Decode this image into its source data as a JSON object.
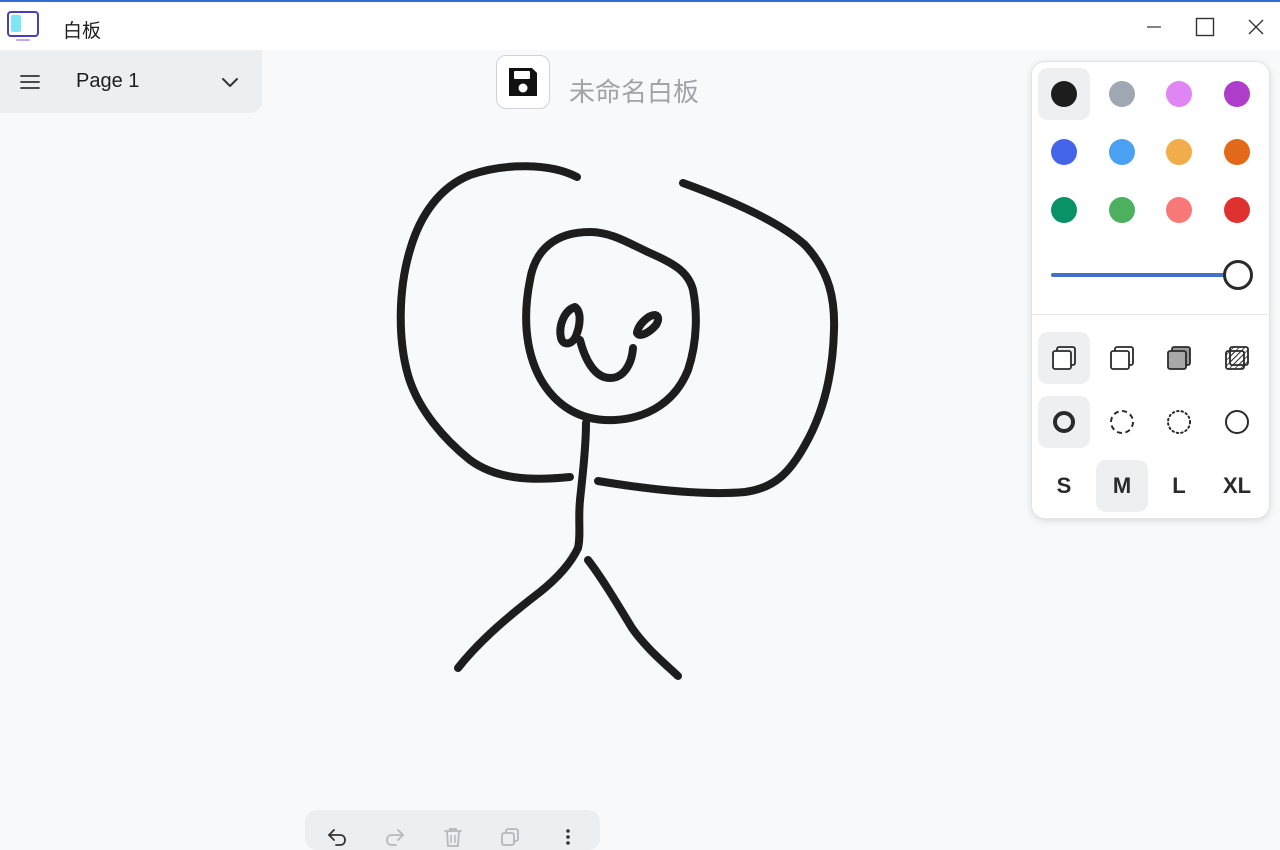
{
  "window": {
    "title": "白板",
    "accent_color": "#2f6fd0",
    "controls": [
      "minimize-icon",
      "maximize-icon",
      "close-icon"
    ]
  },
  "page_menu": {
    "page_label": "Page 1",
    "icons": [
      "hamburger-menu-icon",
      "chevron-down-icon"
    ]
  },
  "header": {
    "save_icon": "floppy-disk-icon",
    "board_name": "未命名白板"
  },
  "style_panel": {
    "colors": [
      {
        "name": "black",
        "hex": "#1d1d1d",
        "selected": true
      },
      {
        "name": "grey",
        "hex": "#9fa8b2",
        "selected": false
      },
      {
        "name": "light-violet",
        "hex": "#e085f4",
        "selected": false
      },
      {
        "name": "violet",
        "hex": "#ae3ec9",
        "selected": false
      },
      {
        "name": "blue",
        "hex": "#4465e9",
        "selected": false
      },
      {
        "name": "light-blue",
        "hex": "#4ba1f1",
        "selected": false
      },
      {
        "name": "yellow",
        "hex": "#f1ac4b",
        "selected": false
      },
      {
        "name": "orange",
        "hex": "#e16919",
        "selected": false
      },
      {
        "name": "green",
        "hex": "#099268",
        "selected": false
      },
      {
        "name": "light-green",
        "hex": "#4cb05e",
        "selected": false
      },
      {
        "name": "light-red",
        "hex": "#f87777",
        "selected": false
      },
      {
        "name": "red",
        "hex": "#e03131",
        "selected": false
      }
    ],
    "opacity": 1.0,
    "fill_options": [
      {
        "icon": "fill-none-icon",
        "selected": true
      },
      {
        "icon": "fill-semi-icon",
        "selected": false
      },
      {
        "icon": "fill-solid-icon",
        "selected": false
      },
      {
        "icon": "fill-pattern-icon",
        "selected": false
      }
    ],
    "dash_options": [
      {
        "icon": "dash-draw-icon",
        "selected": true
      },
      {
        "icon": "dash-dashed-icon",
        "selected": false
      },
      {
        "icon": "dash-dotted-icon",
        "selected": false
      },
      {
        "icon": "dash-solid-icon",
        "selected": false
      }
    ],
    "sizes": [
      {
        "label": "S",
        "selected": false
      },
      {
        "label": "M",
        "selected": true
      },
      {
        "label": "L",
        "selected": false
      },
      {
        "label": "XL",
        "selected": false
      }
    ]
  },
  "bottom_toolbar": {
    "icons": [
      "undo-icon",
      "redo-icon",
      "delete-icon",
      "duplicate-icon",
      "more-icon"
    ]
  },
  "canvas": {
    "drawing": "stick-figure",
    "stroke_color": "#1d1d1d"
  }
}
